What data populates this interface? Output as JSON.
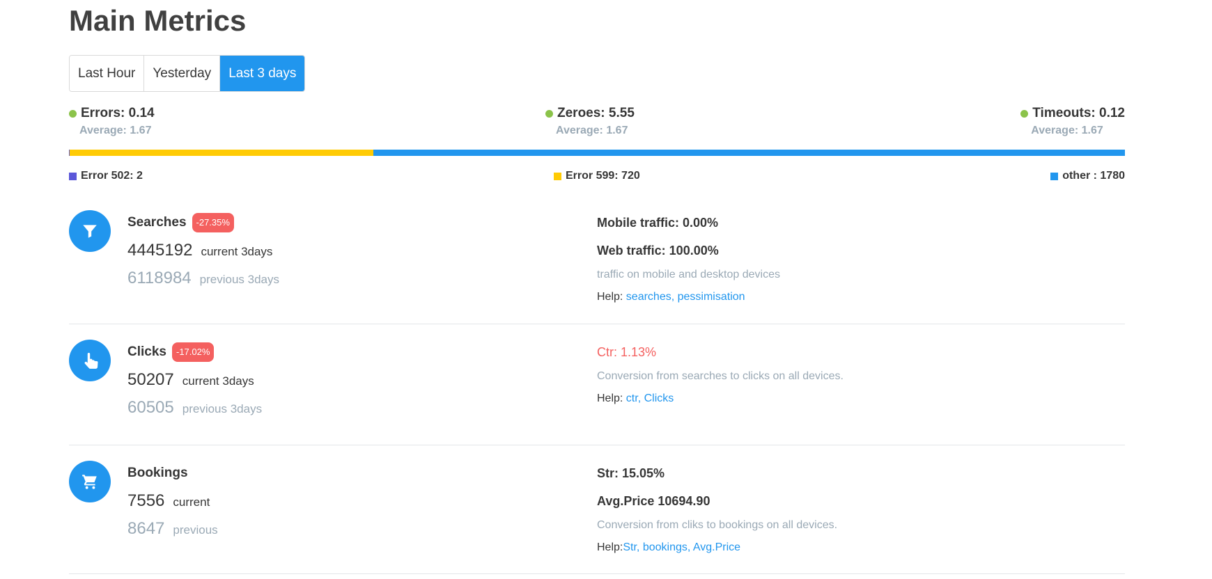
{
  "page": {
    "title": "Main Metrics"
  },
  "period_tabs": [
    {
      "label": "Last Hour",
      "active": false
    },
    {
      "label": "Yesterday",
      "active": false
    },
    {
      "label": "Last 3 days",
      "active": true
    }
  ],
  "stats": {
    "errors": {
      "label": "Errors: 0.14",
      "average": "Average: 1.67",
      "dot_color": "#8bc34a"
    },
    "zeroes": {
      "label": "Zeroes: 5.55",
      "average": "Average: 1.67",
      "dot_color": "#8bc34a"
    },
    "timeouts": {
      "label": "Timeouts: 0.12",
      "average": "Average: 1.67",
      "dot_color": "#8bc34a"
    }
  },
  "error_breakdown": {
    "segments": [
      {
        "name": "Error 502",
        "value": 2,
        "color": "#5b57d9"
      },
      {
        "name": "Error 599",
        "value": 720,
        "color": "#ffcb05"
      },
      {
        "name": "other ",
        "value": 1780,
        "color": "#2196ee"
      }
    ],
    "legend": {
      "e502": "Error 502: 2",
      "e599": "Error 599: 720",
      "other": "other : 1780"
    }
  },
  "metrics": {
    "searches": {
      "icon": "funnel-icon",
      "name": "Searches",
      "change": "-27.35%",
      "current_value": "4445192",
      "current_label": "current 3days",
      "previous_value": "6118984",
      "previous_label": "previous 3days",
      "mobile_traffic": "Mobile traffic: 0.00%",
      "web_traffic": "Web traffic: 100.00%",
      "description": "traffic on mobile and desktop devices",
      "help_label": "Help: ",
      "help_link": "searches, pessimisation"
    },
    "clicks": {
      "icon": "pointer-hand-icon",
      "name": "Clicks",
      "change": "-17.02%",
      "current_value": "50207",
      "current_label": "current 3days",
      "previous_value": "60505",
      "previous_label": "previous 3days",
      "ctr": "Ctr: 1.13%",
      "description": "Conversion from searches to clicks on all devices.",
      "help_label": "Help: ",
      "help_link": "ctr, Clicks"
    },
    "bookings": {
      "icon": "shopping-cart-icon",
      "name": "Bookings",
      "current_value": "7556",
      "current_label": "current",
      "previous_value": "8647",
      "previous_label": "previous",
      "str": "Str: 15.05%",
      "avg_price": "Avg.Price 10694.90",
      "description": "Conversion from cliks to bookings on all devices.",
      "help_label": "Help:",
      "help_link": "Str, bookings, Avg.Price"
    }
  },
  "colors": {
    "accent": "#2196ee",
    "negative": "#f4605f",
    "ok": "#8bc34a",
    "muted": "#9aa9b5"
  }
}
